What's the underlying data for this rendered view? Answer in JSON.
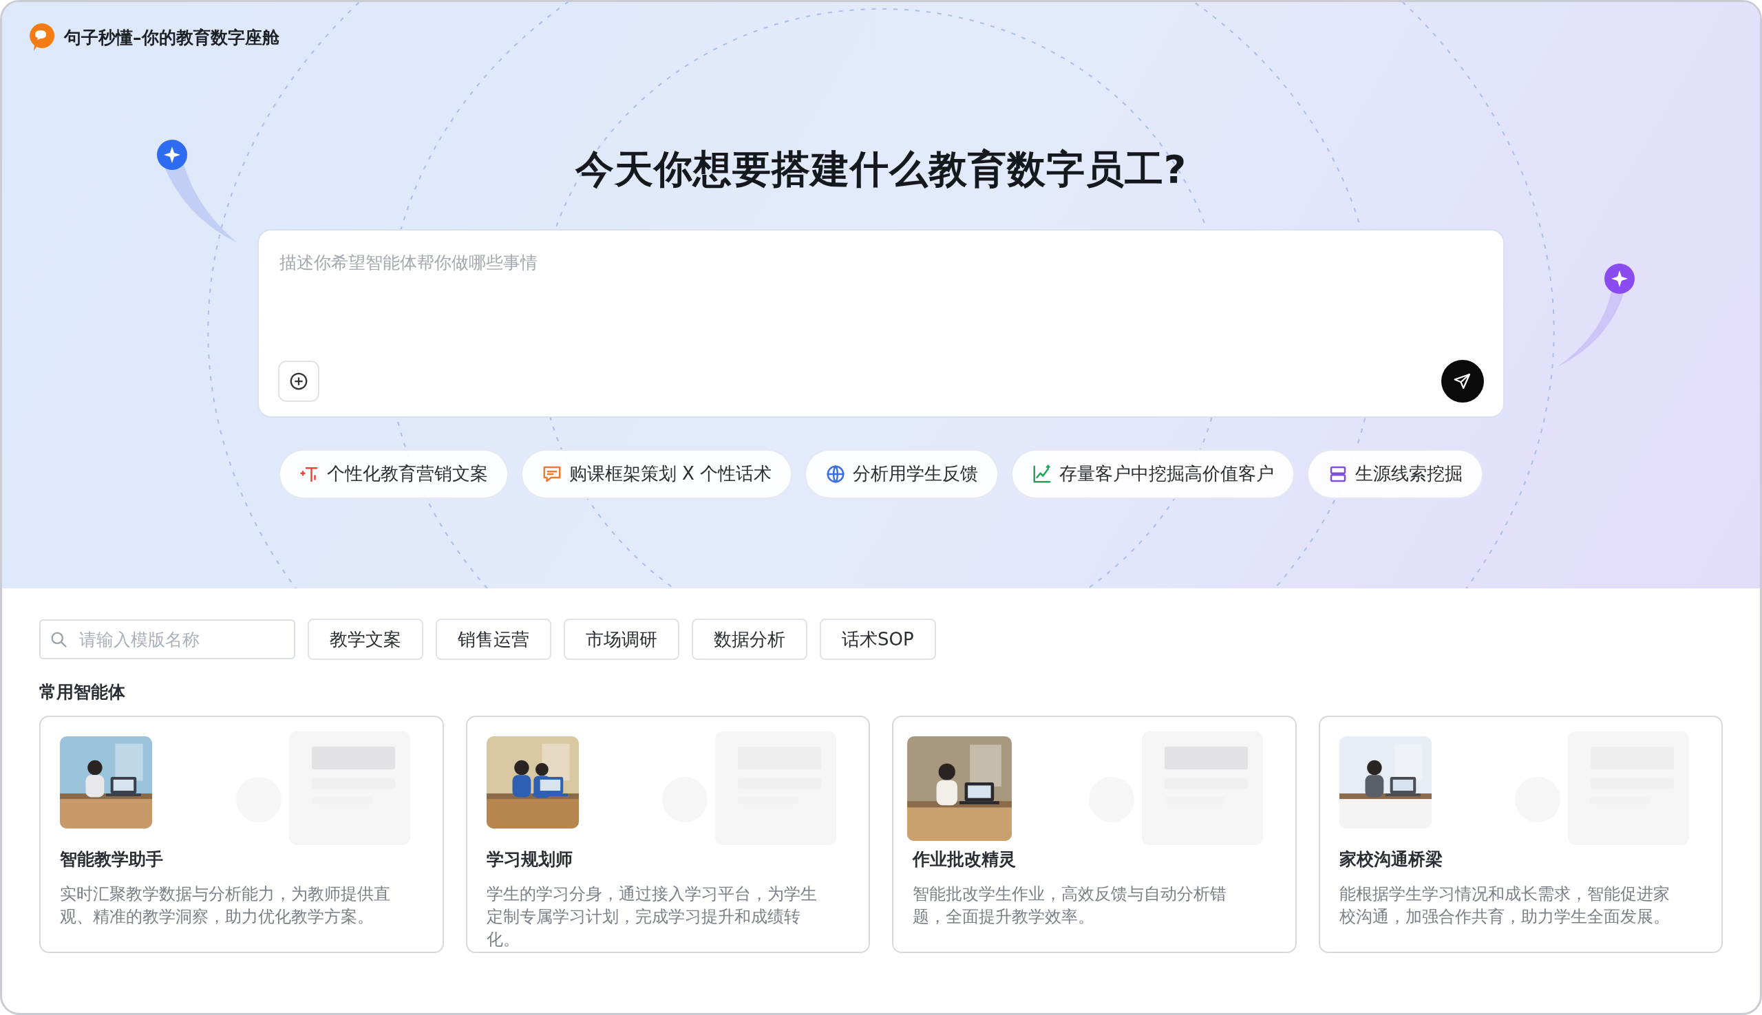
{
  "app": {
    "title": "句子秒懂–你的教育数字座舱"
  },
  "hero": {
    "heading": "今天你想要搭建什么教育数字员工?",
    "prompt": {
      "placeholder": "描述你希望智能体帮你做哪些事情"
    }
  },
  "suggestions": [
    {
      "label": "个性化教育营销文案",
      "kind": "text",
      "color": "#e8453c"
    },
    {
      "label": "购课框架策划 X 个性话术",
      "kind": "chat",
      "color": "#f07b2d"
    },
    {
      "label": "分析用学生反馈",
      "kind": "globe",
      "color": "#3b6fe0"
    },
    {
      "label": "存量客户中挖掘高价值客户",
      "kind": "chart",
      "color": "#22a55a"
    },
    {
      "label": "生源线索挖掘",
      "kind": "stack",
      "color": "#7b4fe0"
    }
  ],
  "templates": {
    "search": {
      "placeholder": "请输入模版名称"
    },
    "categories": [
      {
        "label": "教学文案"
      },
      {
        "label": "销售运营"
      },
      {
        "label": "市场调研"
      },
      {
        "label": "数据分析"
      },
      {
        "label": "话术SOP"
      }
    ]
  },
  "section_title": "常用智能体",
  "agents": [
    {
      "name": "智能教学助手",
      "description": "实时汇聚教学数据与分析能力，为教师提供直观、精准的教学洞察，助力优化教学方案。"
    },
    {
      "name": "学习规划师",
      "description": "学生的学习分身，通过接入学习平台，为学生定制专属学习计划，完成学习提升和成绩转化。"
    },
    {
      "name": "作业批改精灵",
      "description": "智能批改学生作业，高效反馈与自动分析错题，全面提升教学效率。"
    },
    {
      "name": "家校沟通桥梁",
      "description": "能根据学生学习情况和成长需求，智能促进家校沟通，加强合作共育，助力学生全面发展。"
    }
  ]
}
